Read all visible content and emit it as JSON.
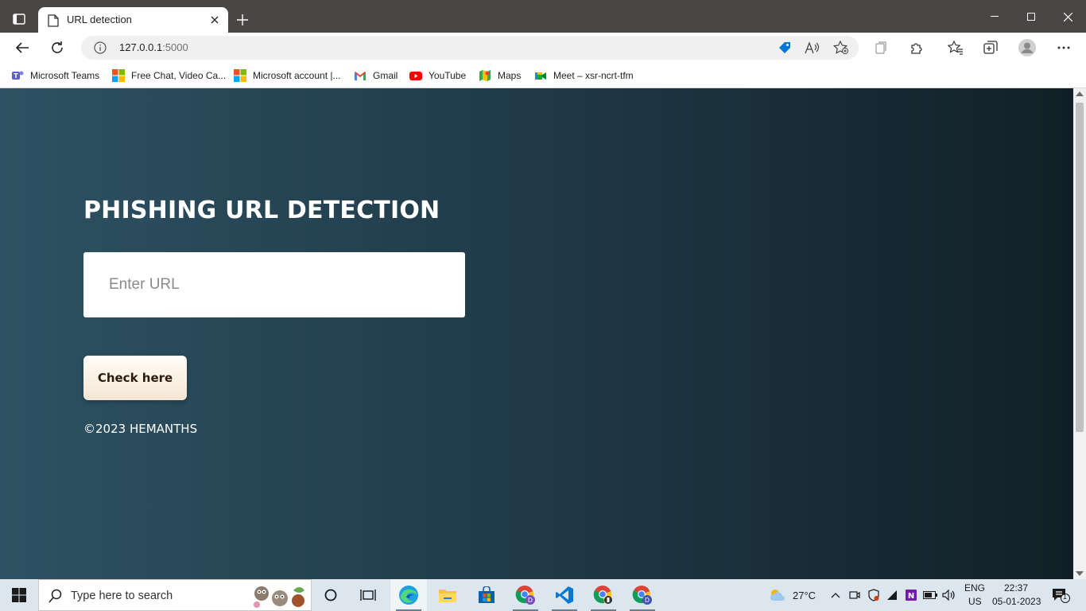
{
  "browser": {
    "tab_title": "URL detection",
    "url_host": "127.0.0.1",
    "url_port": ":5000",
    "accent_color": "#0078d4"
  },
  "bookmarks": [
    {
      "label": "Microsoft Teams",
      "icon": "teams-icon"
    },
    {
      "label": "Free Chat, Video Ca...",
      "icon": "microsoft-logo-icon"
    },
    {
      "label": "Microsoft account |...",
      "icon": "microsoft-logo-icon"
    },
    {
      "label": "Gmail",
      "icon": "gmail-icon"
    },
    {
      "label": "YouTube",
      "icon": "youtube-icon"
    },
    {
      "label": "Maps",
      "icon": "maps-icon"
    },
    {
      "label": "Meet – xsr-ncrt-tfm",
      "icon": "meet-icon"
    }
  ],
  "page": {
    "heading": "PHISHING URL DETECTION",
    "input_placeholder": "Enter URL",
    "input_value": "",
    "button_label": "Check here",
    "footer": "©2023 HEMANTHS",
    "background_from": "#2d5263",
    "background_to": "#112027"
  },
  "taskbar": {
    "search_placeholder": "Type here to search",
    "temperature": "27°C",
    "language": "ENG",
    "region": "US",
    "time": "22:37",
    "date": "05-01-2023",
    "notification_count": "1"
  }
}
